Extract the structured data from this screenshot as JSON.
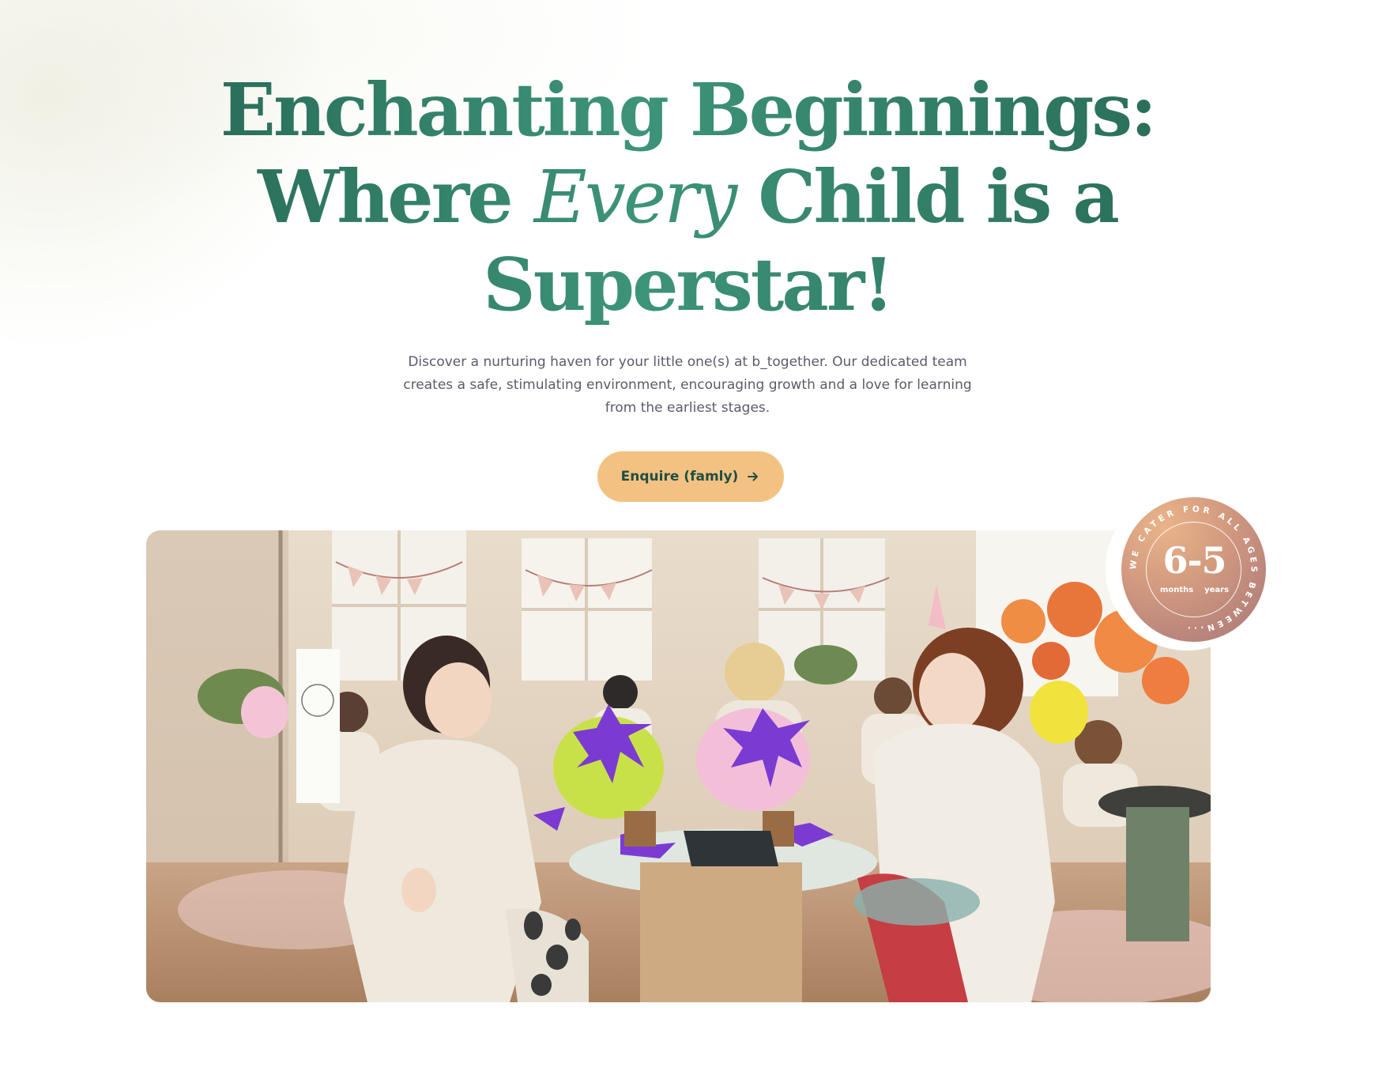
{
  "hero": {
    "headline_line1": "Enchanting Beginnings:",
    "headline_line2_pre": "Where ",
    "headline_line2_em": "Every",
    "headline_line2_post": " Child is a",
    "headline_line3": "Superstar!",
    "subtitle": "Discover a nurturing haven for your little one(s) at b_together. Our dedicated team creates a safe, stimulating environment, encouraging growth and a love for learning from the earliest stages.",
    "cta_label": "Enquire (famly)",
    "cta_icon": "arrow-right-icon"
  },
  "photo": {
    "description_icon": "children-art-class-photo"
  },
  "age_badge": {
    "ring_text": "WE CATER FOR ALL AGES BETWEEN...",
    "range": "6-5",
    "from_unit": "months",
    "to_unit": "years"
  },
  "colors": {
    "headline": "#2f7a66",
    "cta_bg": "#f3c282",
    "cta_text": "#1f4f43",
    "body_text": "#5d5a6b",
    "badge": "#c99080"
  }
}
